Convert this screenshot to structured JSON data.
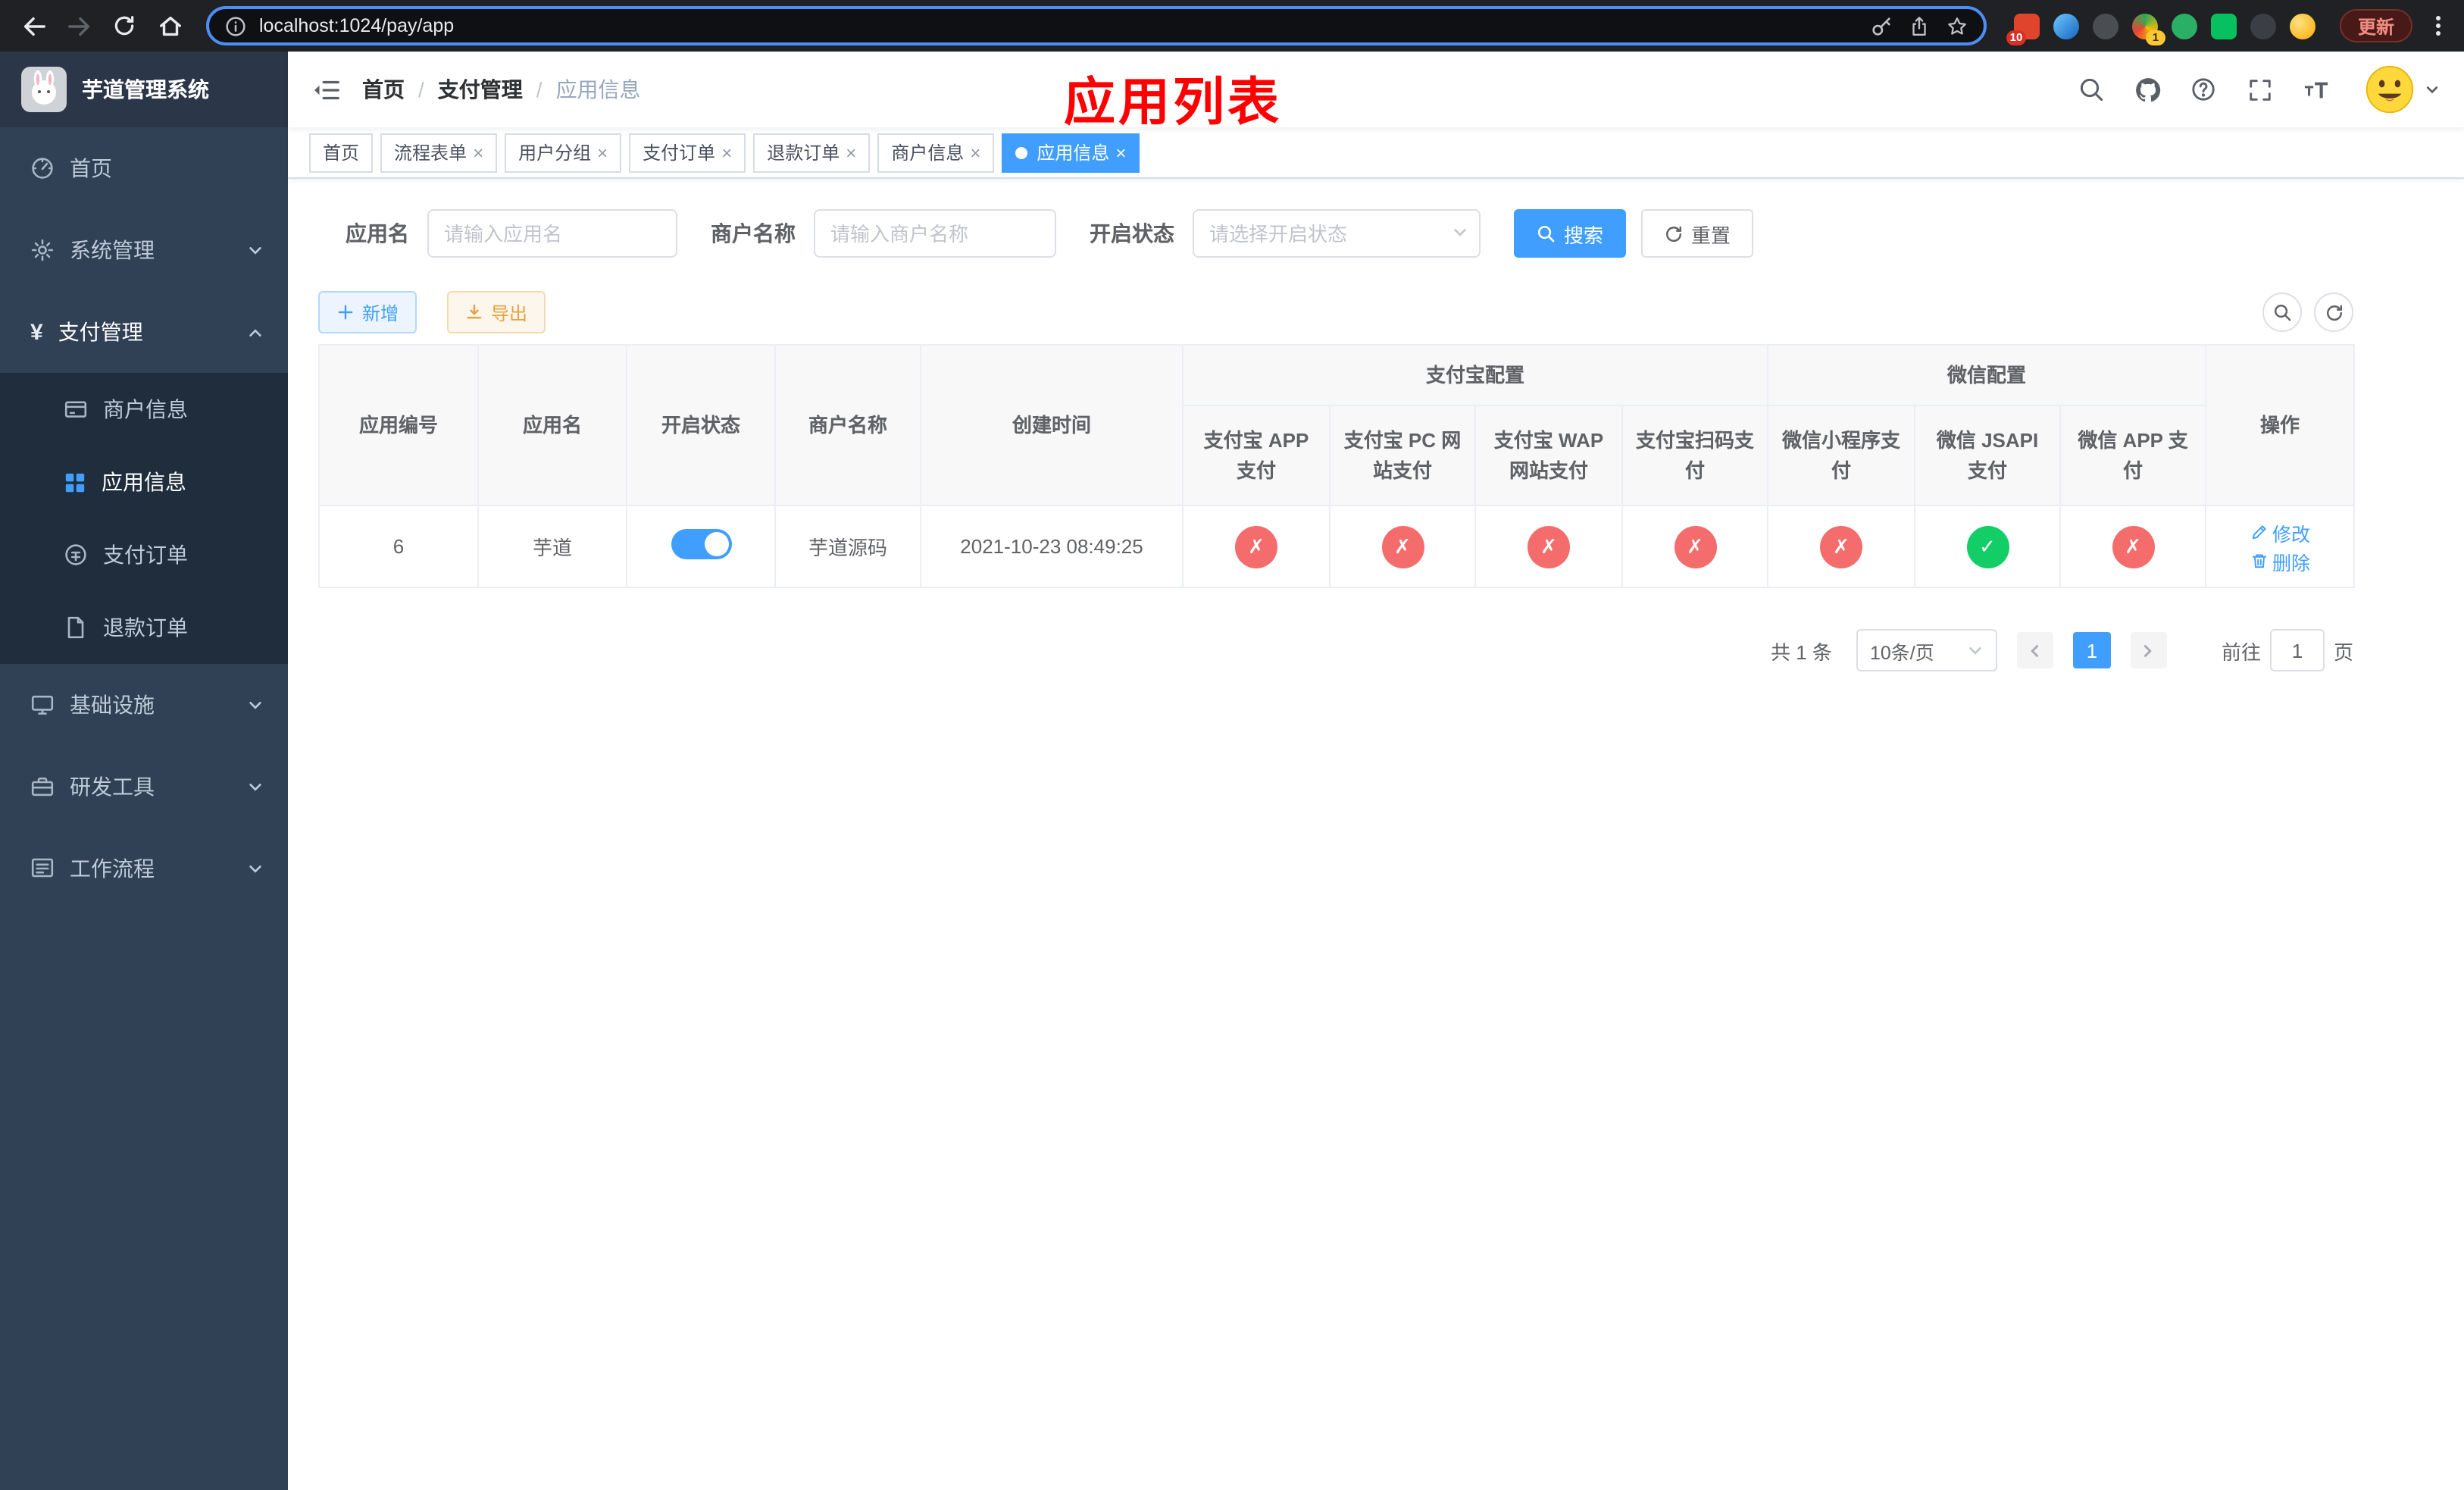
{
  "colors": {
    "accent": "#409eff",
    "danger": "#f56c6c",
    "success": "#13ce66",
    "warning": "#e6a23c",
    "annotation_red": "#ff0000"
  },
  "browser": {
    "url": "localhost:1024/pay/app",
    "update_label": "更新",
    "ext_badge_1": "10",
    "ext_badge_2": "1"
  },
  "sidebar": {
    "title": "芋道管理系统",
    "items": [
      {
        "label": "首页"
      },
      {
        "label": "系统管理"
      },
      {
        "label": "支付管理"
      },
      {
        "label": "基础设施"
      },
      {
        "label": "研发工具"
      },
      {
        "label": "工作流程"
      }
    ],
    "payment_children": [
      {
        "label": "商户信息"
      },
      {
        "label": "应用信息"
      },
      {
        "label": "支付订单"
      },
      {
        "label": "退款订单"
      }
    ]
  },
  "navbar": {
    "breadcrumb": [
      "首页",
      "支付管理",
      "应用信息"
    ],
    "overlay_title": "应用列表"
  },
  "tags": [
    {
      "label": "首页"
    },
    {
      "label": "流程表单"
    },
    {
      "label": "用户分组"
    },
    {
      "label": "支付订单"
    },
    {
      "label": "退款订单"
    },
    {
      "label": "商户信息"
    },
    {
      "label": "应用信息"
    }
  ],
  "filters": {
    "app_name_label": "应用名",
    "app_name_placeholder": "请输入应用名",
    "merchant_label": "商户名称",
    "merchant_placeholder": "请输入商户名称",
    "status_label": "开启状态",
    "status_placeholder": "请选择开启状态",
    "search_label": "搜索",
    "reset_label": "重置"
  },
  "toolbar": {
    "add_label": "新增",
    "export_label": "导出"
  },
  "table": {
    "groups": {
      "alipay": "支付宝配置",
      "wechat": "微信配置"
    },
    "columns": [
      "应用编号",
      "应用名",
      "开启状态",
      "商户名称",
      "创建时间",
      "支付宝 APP 支付",
      "支付宝 PC 网站支付",
      "支付宝 WAP 网站支付",
      "支付宝扫码支付",
      "微信小程序支付",
      "微信 JSAPI 支付",
      "微信 APP 支付",
      "操作"
    ],
    "rows": [
      {
        "id": "6",
        "name": "芋道",
        "enabled": true,
        "merchant": "芋道源码",
        "created": "2021-10-23 08:49:25",
        "statuses": [
          "no",
          "no",
          "no",
          "no",
          "no",
          "yes",
          "no"
        ],
        "edit_label": "修改",
        "delete_label": "删除"
      }
    ]
  },
  "pagination": {
    "total": "共 1 条",
    "page_size": "10条/页",
    "current_page": "1",
    "goto_label": "前往",
    "goto_value": "1",
    "page_unit": "页"
  }
}
